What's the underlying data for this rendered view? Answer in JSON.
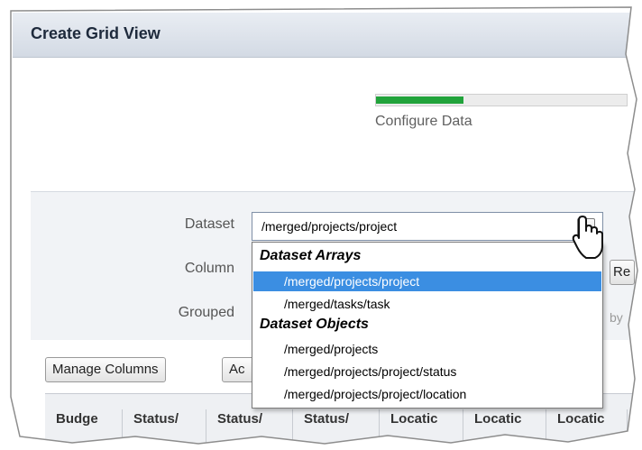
{
  "window": {
    "title": "Create Grid View"
  },
  "wizard": {
    "progress": 0.35,
    "step_label": "Configure Data"
  },
  "form": {
    "dataset_label": "Dataset",
    "column_label": "Column",
    "grouped_label": "Grouped",
    "dataset_value": "/merged/projects/project",
    "re_button": "Re",
    "by_text": "by"
  },
  "dropdown": {
    "groups": [
      {
        "label": "Dataset Arrays",
        "items": [
          "/merged/projects/project",
          "/merged/tasks/task"
        ]
      },
      {
        "label": "Dataset Objects",
        "items": [
          "/merged/projects",
          "/merged/projects/project/status",
          "/merged/projects/project/location"
        ]
      }
    ],
    "selected": "/merged/projects/project"
  },
  "toolbar": {
    "manage_columns_label": "Manage Columns",
    "add_label": "Ac"
  },
  "grid": {
    "columns": [
      "Budge",
      "Status/",
      "Status/",
      "Status/",
      "Locatic",
      "Locatic",
      "Locatic"
    ]
  },
  "icons": {
    "cursor": "hand-pointer-icon",
    "dropdown_arrow": "chevron-down-icon"
  },
  "colors": {
    "accent": "#21a33b",
    "selection": "#3b8ee2",
    "header": "#dde3eb"
  }
}
